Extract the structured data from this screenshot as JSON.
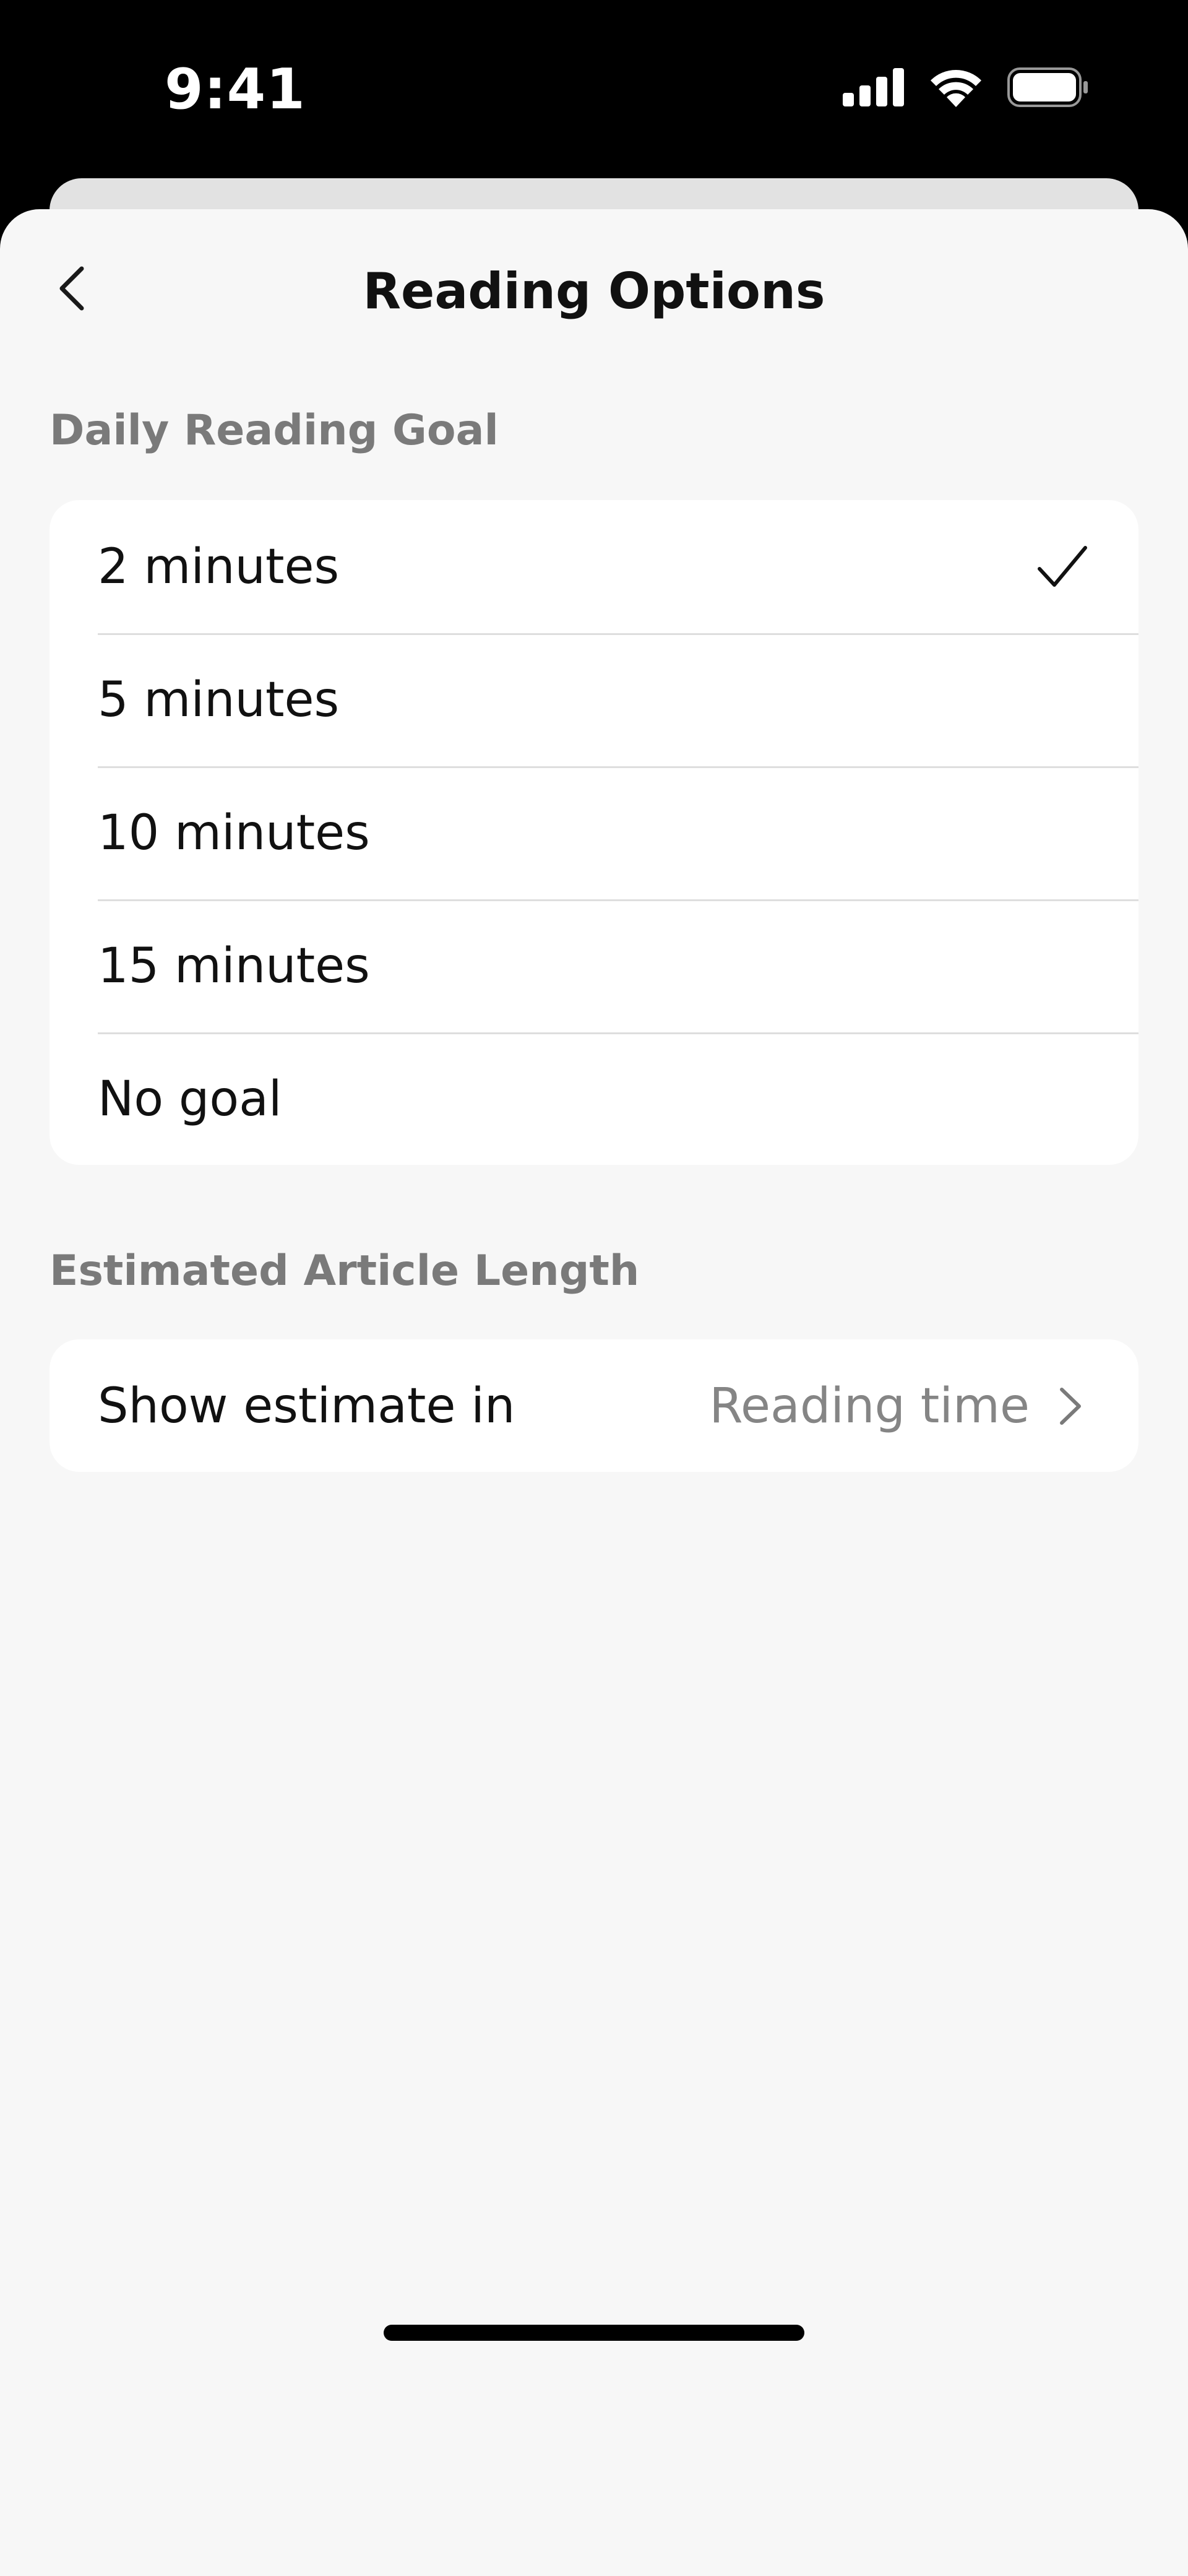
{
  "status_bar": {
    "time": "9:41",
    "icons": [
      "cellular-signal-icon",
      "wifi-icon",
      "battery-icon"
    ]
  },
  "nav": {
    "back_icon": "chevron-left-icon",
    "title": "Reading Options"
  },
  "daily_goal": {
    "header": "Daily Reading Goal",
    "options": [
      {
        "label": "2 minutes",
        "selected": true
      },
      {
        "label": "5 minutes",
        "selected": false
      },
      {
        "label": "10 minutes",
        "selected": false
      },
      {
        "label": "15 minutes",
        "selected": false
      },
      {
        "label": "No goal",
        "selected": false
      }
    ],
    "selected_icon": "checkmark-icon"
  },
  "article_length": {
    "header": "Estimated Article Length",
    "row": {
      "label": "Show estimate in",
      "value": "Reading time",
      "icon": "chevron-right-icon"
    }
  },
  "colors": {
    "background": "#f7f7f7",
    "card": "#ffffff",
    "text_primary": "#111111",
    "text_secondary": "#7a7a7a",
    "separator": "#dedede"
  }
}
